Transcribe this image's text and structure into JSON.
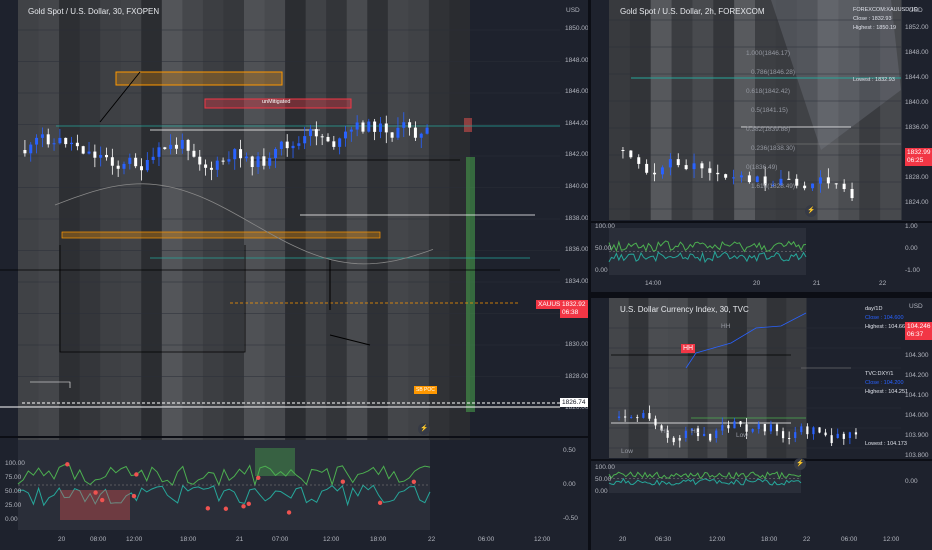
{
  "colors": {
    "up": "#2962ff",
    "down": "#ffffff",
    "teal": "#26a69a",
    "orange": "#ff9800",
    "red": "#ef5350",
    "pink": "#f23645",
    "green": "#4caf50",
    "bg": "#1e222d"
  },
  "left": {
    "title": "Gold Spot / U.S. Dollar, 30, FXOPEN",
    "currency": "USD",
    "price_ticks": [
      "1850.00",
      "1848.00",
      "1846.00",
      "1844.00",
      "1842.00",
      "1840.00",
      "1838.00",
      "1836.00",
      "1834.00",
      "1832.00",
      "1830.00",
      "1828.00",
      "1826.00"
    ],
    "symbol_tag": "XAUUSD",
    "price_tag": "1832.92",
    "countdown": "06:38",
    "level_tag": "1826.74",
    "poc_label": "SB POC",
    "box_label": "unMitigated",
    "osc_ticks_left": [
      "100.00",
      "75.00",
      "50.00",
      "25.00",
      "0.00"
    ],
    "osc_ticks_right": [
      "0.50",
      "0.00",
      "-0.50"
    ],
    "time_ticks": [
      "20",
      "08:00",
      "12:00",
      "18:00",
      "21",
      "07:00",
      "12:00",
      "18:00",
      "22",
      "06:00",
      "12:00"
    ],
    "flash_icon": "lightning-icon"
  },
  "top_right": {
    "title": "Gold Spot / U.S. Dollar, 2h, FOREXCOM",
    "currency": "USD",
    "info": [
      "FOREXCOM:XAUUSD/1D",
      "Close : 1832.93",
      "Highest : 1850.19"
    ],
    "lowest_label": "Lowest : 1832.93",
    "price_ticks": [
      "1852.00",
      "1848.00",
      "1844.00",
      "1840.00",
      "1836.00",
      "1832.00",
      "1828.00",
      "1824.00"
    ],
    "price_tag": "1832.99",
    "countdown": "06:25",
    "fibs": [
      "1.000(1846.17)",
      "0.786(1846.28)",
      "0.618(1842.42)",
      "0.5(1841.15)",
      "0.382(1839.88)",
      "0.236(1838.30)",
      "0(1836.49)",
      "1.618(1828.49)"
    ],
    "osc_ticks_left": [
      "100.00",
      "50.00",
      "0.00"
    ],
    "osc_ticks_right": [
      "1.00",
      "0.00",
      "-1.00"
    ],
    "time_ticks": [
      "14:00",
      "20",
      "21",
      "22"
    ],
    "flash_icon": "lightning-icon"
  },
  "bottom_right": {
    "title": "U.S. Dollar Currency Index, 30, TVC",
    "currency": "USD",
    "info_top": [
      "day/1D",
      "Close : 104.600",
      "Highest : 104.667"
    ],
    "info_mid": [
      "TVC:DXY/1",
      "Close : 104.200",
      "Highest : 104.251"
    ],
    "lowest_label": "Lowest : 104.173",
    "price_ticks": [
      "104.400",
      "104.300",
      "104.200",
      "104.100",
      "104.000",
      "103.900",
      "103.800"
    ],
    "price_tag": "104.246",
    "countdown": "06:37",
    "structure_labels": [
      "HH",
      "HL",
      "Low",
      "HL",
      "Low",
      "HH"
    ],
    "osc_ticks_left": [
      "100.00",
      "50.00",
      "0.00"
    ],
    "osc_ticks_right": [
      "0.00"
    ],
    "time_ticks": [
      "20",
      "06:30",
      "12:00",
      "18:00",
      "22",
      "06:00",
      "12:00"
    ],
    "flash_icon": "lightning-icon"
  }
}
